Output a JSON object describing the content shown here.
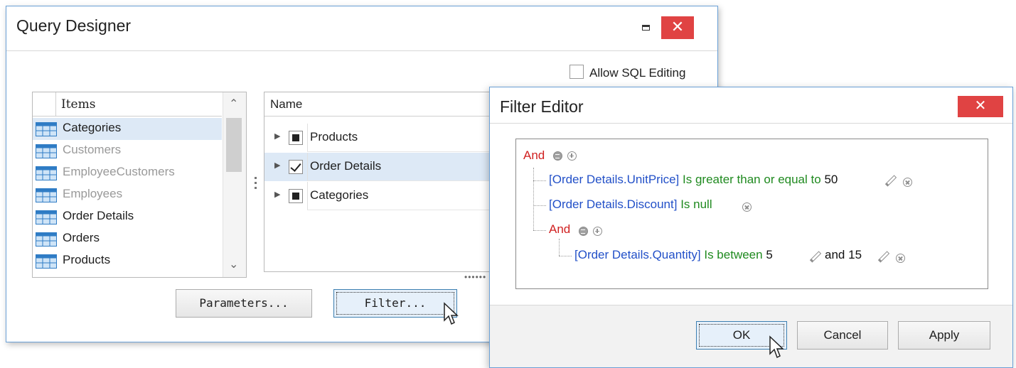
{
  "query_designer": {
    "title": "Query Designer",
    "allow_sql_label": "Allow SQL Editing",
    "items_header": "Items",
    "items": [
      {
        "label": "Categories",
        "state": "selected"
      },
      {
        "label": "Customers",
        "state": "dimmed"
      },
      {
        "label": "EmployeeCustomers",
        "state": "dimmed"
      },
      {
        "label": "Employees",
        "state": "dimmed"
      },
      {
        "label": "Order Details",
        "state": "normal"
      },
      {
        "label": "Orders",
        "state": "normal"
      },
      {
        "label": "Products",
        "state": "normal"
      }
    ],
    "tree_header": "Name",
    "tree_rows": [
      {
        "label": "Products",
        "check": "partial"
      },
      {
        "label": "Order Details",
        "check": "checked"
      },
      {
        "label": "Categories",
        "check": "partial"
      }
    ],
    "parameters_label": "Parameters...",
    "filter_label": "Filter..."
  },
  "filter_editor": {
    "title": "Filter Editor",
    "root_op": "And",
    "cond1": {
      "field": "[Order Details.UnitPrice]",
      "op": "Is greater than or equal to",
      "value": "50"
    },
    "cond2": {
      "field": "[Order Details.Discount]",
      "op": "Is null"
    },
    "group_op": "And",
    "cond3": {
      "field": "[Order Details.Quantity]",
      "op": "Is between",
      "value1": "5",
      "and": "and",
      "value2": "15"
    },
    "ok_label": "OK",
    "cancel_label": "Cancel",
    "apply_label": "Apply"
  },
  "icons": {
    "close": "close-icon",
    "minimize": "minimize-icon",
    "table": "table-icon",
    "cursor": "mouse-cursor-icon"
  },
  "colors": {
    "close_button": "#e04343",
    "selection": "#dde9f6",
    "group_operator": "#d02020",
    "field": "#2250c8",
    "operator": "#1f8a1f",
    "border": "#6aa0d6"
  }
}
